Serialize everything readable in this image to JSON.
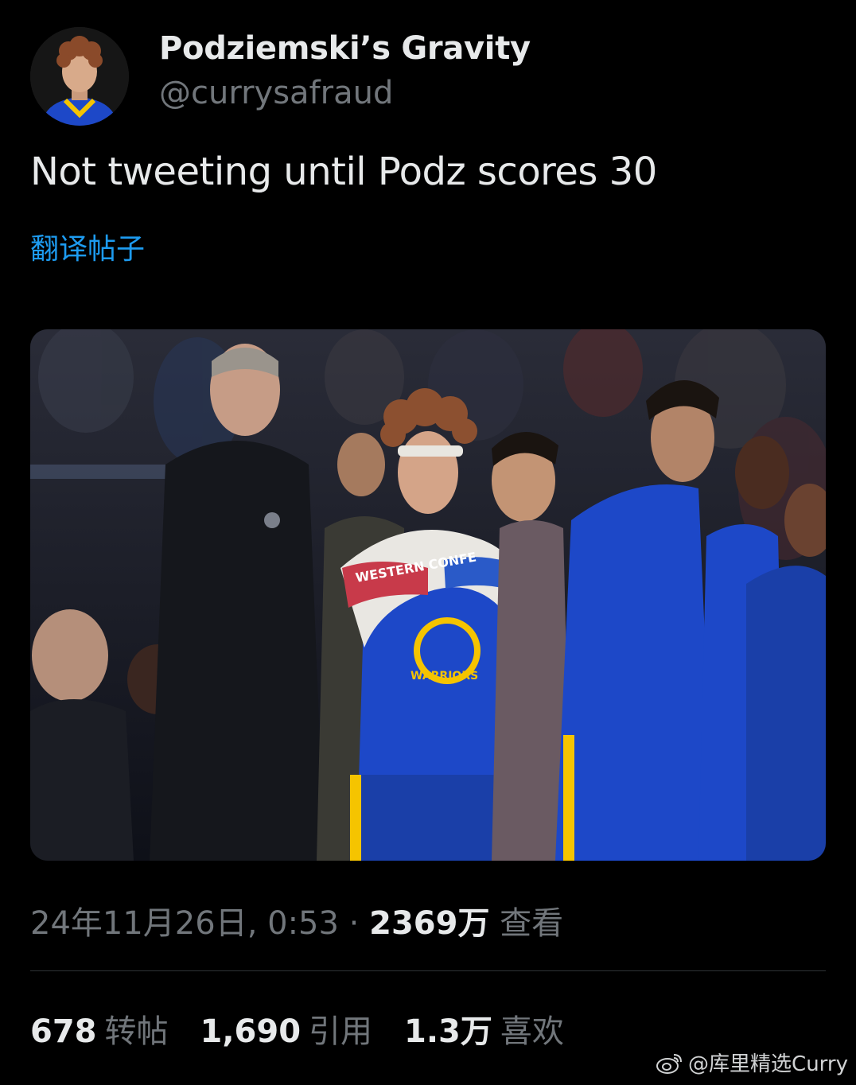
{
  "tweet": {
    "author": {
      "display_name": "Podziemski’s Gravity",
      "handle": "@currysafraud"
    },
    "text": "Not tweeting until Podz scores 30",
    "translate_label": "翻译帖子",
    "media": {
      "jersey_lettering": "WARRIORS",
      "towel_lettering": "WESTERN CONFE"
    },
    "meta": {
      "timestamp": "24年11月26日, 0:53",
      "separator": " · ",
      "views_count": "2369万",
      "views_label": "查看"
    },
    "stats": {
      "reposts_count": "678",
      "reposts_label": "转帖",
      "quotes_count": "1,690",
      "quotes_label": "引用",
      "likes_count": "1.3万",
      "likes_label": "喜欢"
    }
  },
  "watermark": {
    "icon": "weibo-icon",
    "text": "@库里精选Curry"
  },
  "colors": {
    "background": "#000000",
    "text_primary": "#e7e9ea",
    "text_secondary": "#71767b",
    "link": "#1d9bf0",
    "divider": "#2f3336",
    "warriors_blue": "#1d48c8",
    "warriors_gold": "#f5c400"
  }
}
